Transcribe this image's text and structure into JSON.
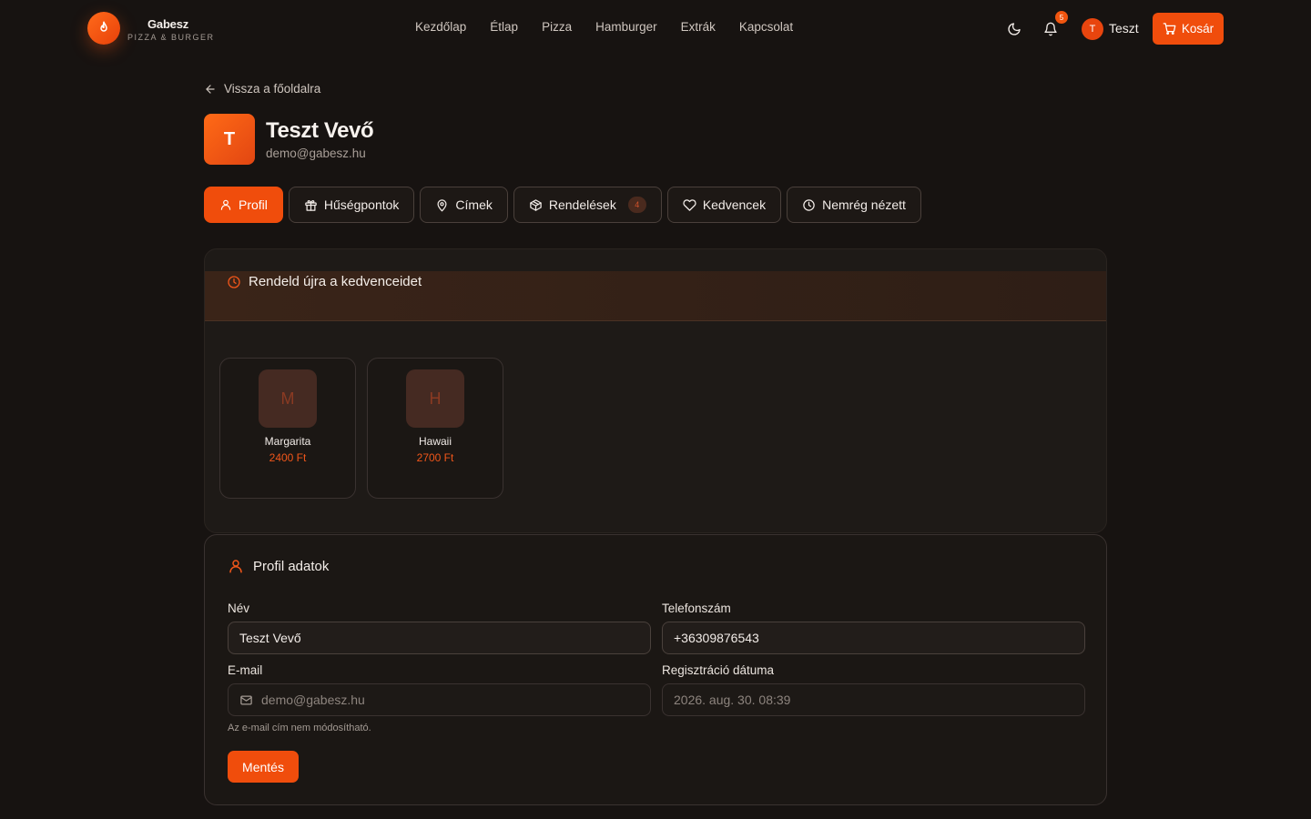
{
  "brand": {
    "name": "Gabesz",
    "tagline": "PIZZA & BURGER"
  },
  "nav": {
    "items": [
      {
        "label": "Kezdőlap"
      },
      {
        "label": "Étlap"
      },
      {
        "label": "Pizza"
      },
      {
        "label": "Hamburger"
      },
      {
        "label": "Extrák"
      },
      {
        "label": "Kapcsolat"
      }
    ]
  },
  "header": {
    "notifications_count": "5",
    "user_initial": "T",
    "user_name": "Teszt",
    "cart_label": "Kosár"
  },
  "back_link": "Vissza a főoldalra",
  "profile": {
    "initial": "T",
    "name": "Teszt Vevő",
    "email": "demo@gabesz.hu"
  },
  "tabs": [
    {
      "label": "Profil",
      "icon": "user-icon",
      "active": true
    },
    {
      "label": "Hűségpontok",
      "icon": "gift-icon"
    },
    {
      "label": "Címek",
      "icon": "map-pin-icon"
    },
    {
      "label": "Rendelések",
      "icon": "package-icon",
      "count": "4"
    },
    {
      "label": "Kedvencek",
      "icon": "heart-icon"
    },
    {
      "label": "Nemrég nézett",
      "icon": "clock-icon"
    }
  ],
  "reorder": {
    "title": "Rendeld újra a kedvenceidet",
    "items": [
      {
        "initial": "M",
        "name": "Margarita",
        "price": "2400 Ft"
      },
      {
        "initial": "H",
        "name": "Hawaii",
        "price": "2700 Ft"
      }
    ]
  },
  "profile_form": {
    "title": "Profil adatok",
    "name_label": "Név",
    "name_value": "Teszt Vevő",
    "phone_label": "Telefonszám",
    "phone_value": "+36309876543",
    "email_label": "E-mail",
    "email_value": "demo@gabesz.hu",
    "email_hint": "Az e-mail cím nem módosítható.",
    "reg_label": "Regisztráció dátuma",
    "reg_value": "2026. aug. 30. 08:39",
    "save_label": "Mentés"
  },
  "colors": {
    "accent": "#f04d0c",
    "background": "#171311"
  }
}
